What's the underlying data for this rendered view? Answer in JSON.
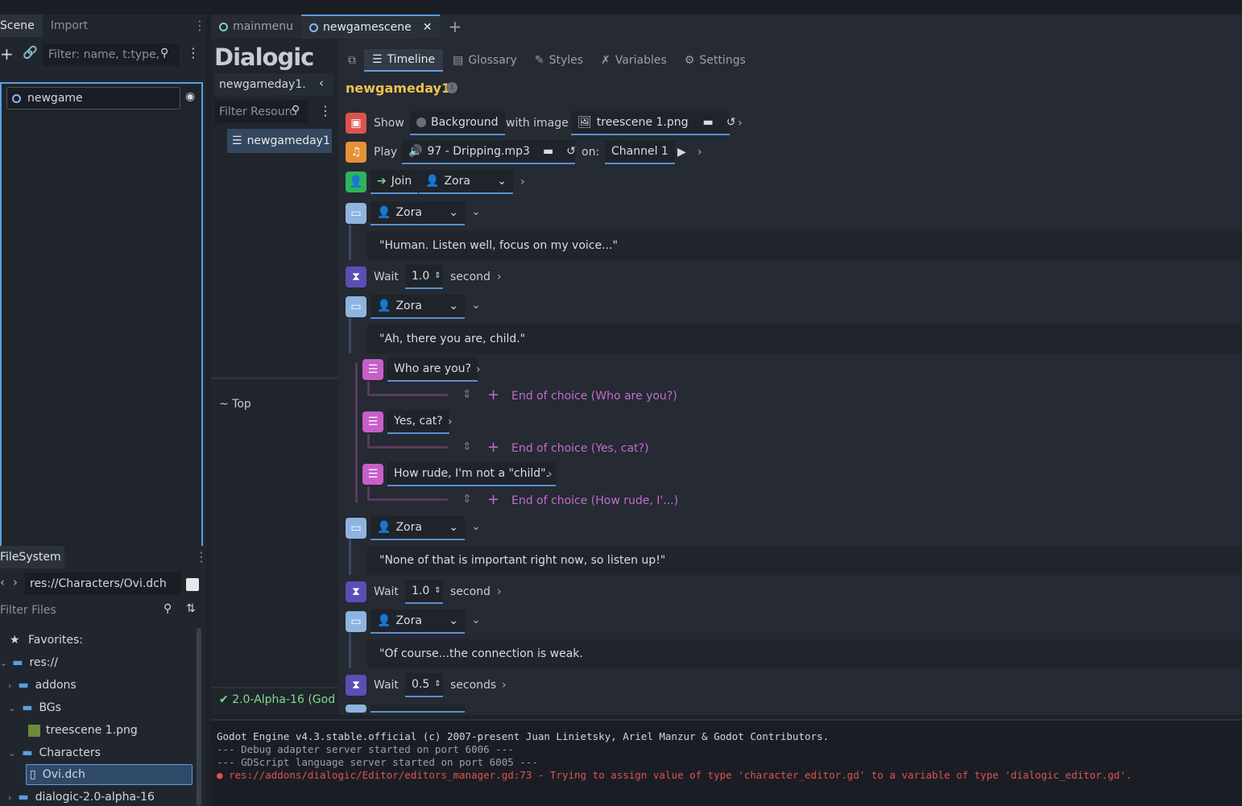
{
  "scene_dock": {
    "tabs": [
      "Scene",
      "Import"
    ],
    "filter_placeholder": "Filter: name, t:type,",
    "root_node": "newgame"
  },
  "filesystem": {
    "tab": "FileSystem",
    "path": "res://Characters/Ovi.dch",
    "filter_placeholder": "Filter Files",
    "items": [
      {
        "label": "Favorites:",
        "icon": "star-icon"
      },
      {
        "label": "res://",
        "icon": "folder-icon"
      },
      {
        "label": "addons",
        "icon": "folder-icon"
      },
      {
        "label": "BGs",
        "icon": "folder-icon"
      },
      {
        "label": "treescene 1.png",
        "icon": "image-file-icon"
      },
      {
        "label": "Characters",
        "icon": "folder-icon"
      },
      {
        "label": "Ovi.dch",
        "icon": "file-icon"
      },
      {
        "label": "dialogic-2.0-alpha-16",
        "icon": "folder-icon"
      }
    ]
  },
  "scene_tabs": [
    {
      "label": "mainmenu"
    },
    {
      "label": "newgamescene"
    }
  ],
  "dialogic": {
    "logo": "Dialogic",
    "tabs": [
      "Timeline",
      "Glossary",
      "Styles",
      "Variables",
      "Settings"
    ],
    "resource_tab": "newgameday1.",
    "filter_resources_placeholder": "Filter Resourc",
    "resource_item": "newgameday1",
    "top_label": "~ Top",
    "version": "2.0-Alpha-16 (God",
    "timeline_title": "newgameday1"
  },
  "timeline": {
    "show": {
      "verb": "Show",
      "target": "Background",
      "with": "with image",
      "file": "treescene 1.png"
    },
    "play": {
      "verb": "Play",
      "file": "97 - Dripping.mp3",
      "on": "on:",
      "channel": "Channel 1"
    },
    "join": {
      "verb": "Join",
      "character": "Zora"
    },
    "text1": {
      "character": "Zora",
      "text": "\"Human. Listen well, focus on my voice...\""
    },
    "wait1": {
      "verb": "Wait",
      "value": "1.0",
      "unit": "second"
    },
    "text2": {
      "character": "Zora",
      "text": "\"Ah, there you are, child.\""
    },
    "choices": [
      {
        "label": "Who are you?",
        "end": "End of choice (Who are you?)"
      },
      {
        "label": "Yes, cat?",
        "end": "End of choice (Yes, cat?)"
      },
      {
        "label": "How rude, I'm not a \"child\".",
        "end": "End of choice (How rude, I'...)"
      }
    ],
    "text3": {
      "character": "Zora",
      "text": "\"None of that is important right now, so listen up!\""
    },
    "wait2": {
      "verb": "Wait",
      "value": "1.0",
      "unit": "second"
    },
    "text4": {
      "character": "Zora",
      "text": "\"Of course...the connection is weak."
    },
    "wait3": {
      "verb": "Wait",
      "value": "0.5",
      "unit": "seconds"
    }
  },
  "console": {
    "lines": [
      {
        "text": "Godot Engine v4.3.stable.official (c) 2007-present Juan Linietsky, Ariel Manzur & Godot Contributors.",
        "type": "info"
      },
      {
        "text": "--- Debug adapter server started on port 6006 ---",
        "type": "muted"
      },
      {
        "text": "--- GDScript language server started on port 6005 ---",
        "type": "muted"
      },
      {
        "text": "res://addons/dialogic/Editor/editors_manager.gd:73 - Trying to assign value of type 'character_editor.gd' to a variable of type 'dialogic_editor.gd'.",
        "type": "error"
      }
    ]
  },
  "colors": {
    "accent": "#5a9fe2",
    "show_icon": "#d9534f",
    "play_icon": "#e69138",
    "join_icon": "#2db35e",
    "text_icon": "#8fb4e0",
    "wait_icon": "#5a4fb5",
    "choice_icon": "#c85fc9",
    "error": "#e05252",
    "timeline_title": "#f1c14f"
  }
}
